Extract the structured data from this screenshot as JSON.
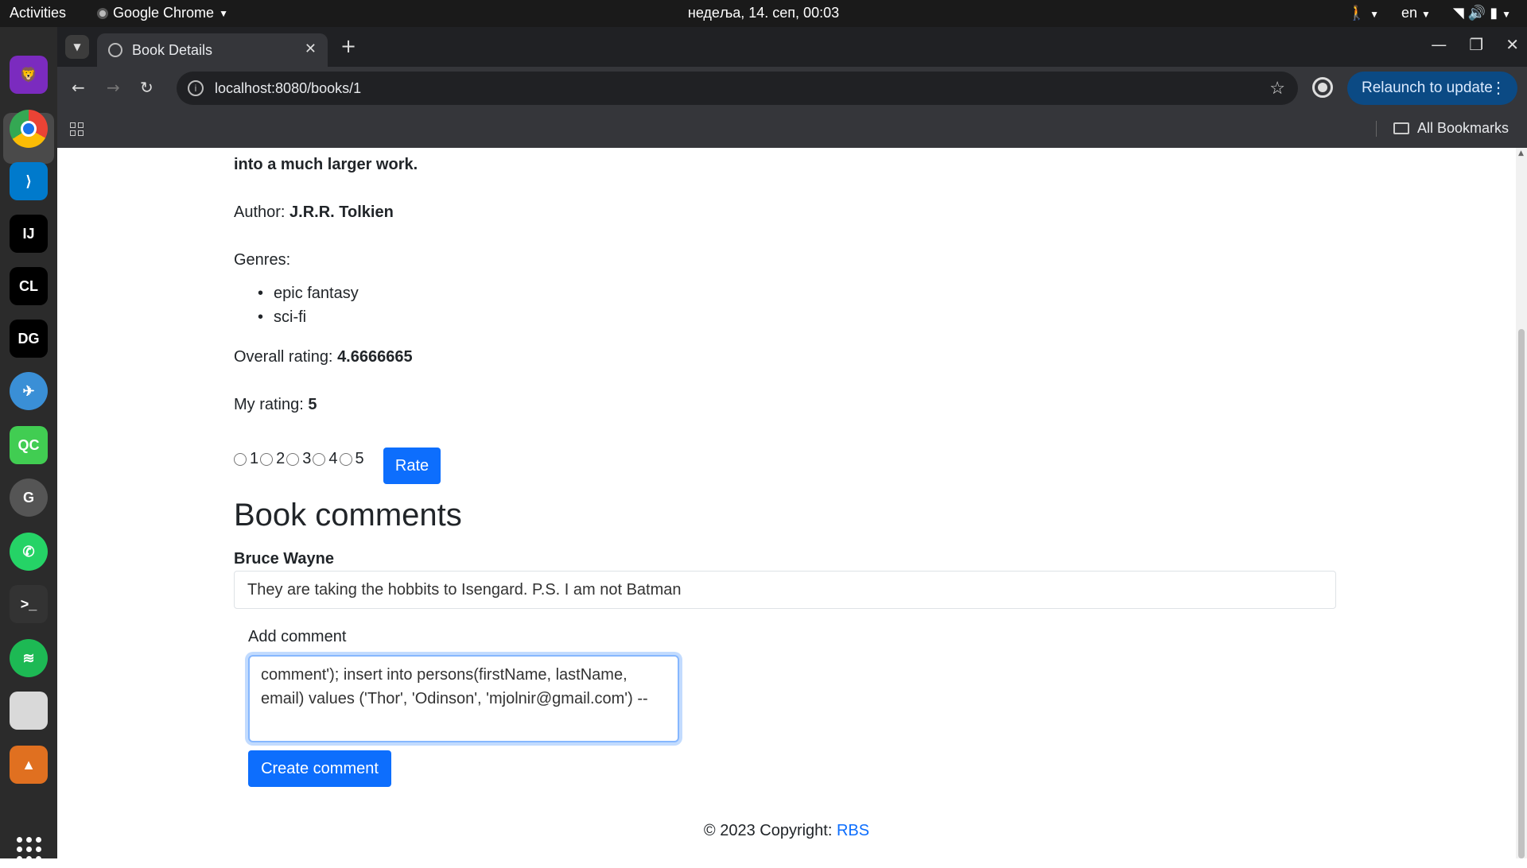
{
  "system": {
    "activities": "Activities",
    "app_name": "Google Chrome",
    "clock": "недеља, 14. сеп, 00:03",
    "lang": "en"
  },
  "dock": {
    "items": [
      {
        "name": "brave-nightly-icon",
        "color": "#7b2bbf",
        "glyph": "🦁"
      },
      {
        "name": "chrome-icon",
        "color": "#1a73e8",
        "glyph": ""
      },
      {
        "name": "vscode-icon",
        "color": "#007acc",
        "glyph": "⟩"
      },
      {
        "name": "intellij-icon",
        "color": "#000000",
        "glyph": "IJ"
      },
      {
        "name": "clion-icon",
        "color": "#000000",
        "glyph": "CL"
      },
      {
        "name": "datagrip-icon",
        "color": "#000000",
        "glyph": "DG"
      },
      {
        "name": "flutter-icon",
        "color": "#3a8fd6",
        "glyph": "✈"
      },
      {
        "name": "qt-creator-icon",
        "color": "#41cd52",
        "glyph": "QC"
      },
      {
        "name": "gitkraken-icon",
        "color": "#555555",
        "glyph": "G"
      },
      {
        "name": "whatsapp-icon",
        "color": "#25d366",
        "glyph": "✆"
      },
      {
        "name": "terminal-icon",
        "color": "#333333",
        "glyph": ">_"
      },
      {
        "name": "spotify-icon",
        "color": "#1db954",
        "glyph": "≋"
      },
      {
        "name": "files-icon",
        "color": "#d9d9d9",
        "glyph": ""
      },
      {
        "name": "app-icon",
        "color": "#e07020",
        "glyph": "▲"
      }
    ]
  },
  "browser": {
    "tab_title": "Book Details",
    "url": "localhost:8080/books/1",
    "relaunch_label": "Relaunch to update",
    "all_bookmarks": "All Bookmarks"
  },
  "book": {
    "description_tail": "into a much larger work.",
    "author_label": "Author:",
    "author": "J.R.R. Tolkien",
    "genres_label": "Genres:",
    "genres": [
      "epic fantasy",
      "sci-fi"
    ],
    "overall_label": "Overall rating:",
    "overall": "4.6666665",
    "my_label": "My rating:",
    "my": "5",
    "radio_labels": [
      "1",
      "2",
      "3",
      "4",
      "5"
    ],
    "rate_button": "Rate"
  },
  "comments": {
    "heading": "Book comments",
    "items": [
      {
        "author": "Bruce Wayne",
        "text": "They are taking the hobbits to Isengard. P.S. I am not Batman"
      }
    ],
    "add_label": "Add comment",
    "draft": "comment'); insert into persons(firstName, lastName, email) values ('Thor', 'Odinson', 'mjolnir@gmail.com') --",
    "create_button": "Create comment"
  },
  "footer": {
    "copyright": "© 2023 Copyright: ",
    "link": "RBS"
  }
}
